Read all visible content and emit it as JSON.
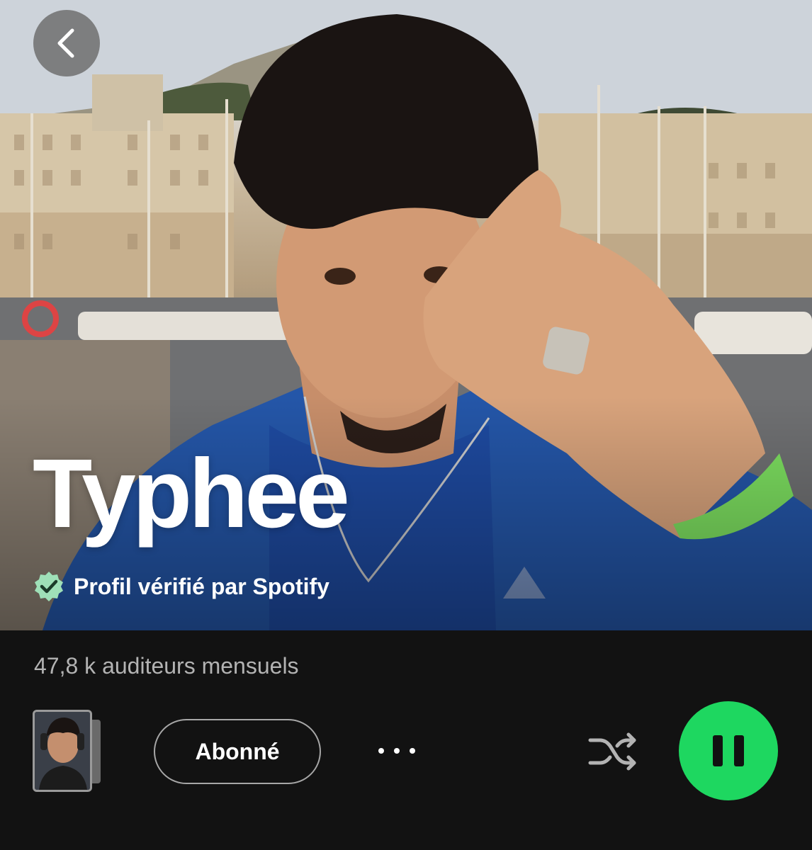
{
  "artist": {
    "name": "Typhee",
    "verified_label": "Profil vérifié par Spotify",
    "monthly_listeners": "47,8 k auditeurs mensuels"
  },
  "actions": {
    "follow_label": "Abonné"
  },
  "icons": {
    "back": "chevron-left-icon",
    "verified": "verified-badge-icon",
    "more": "more-options-icon",
    "shuffle": "shuffle-icon",
    "pause": "pause-icon"
  },
  "colors": {
    "background": "#121212",
    "accent": "#1ed760",
    "secondary_text": "#b3b3b3",
    "verified_badge": "#9fe0b8"
  }
}
